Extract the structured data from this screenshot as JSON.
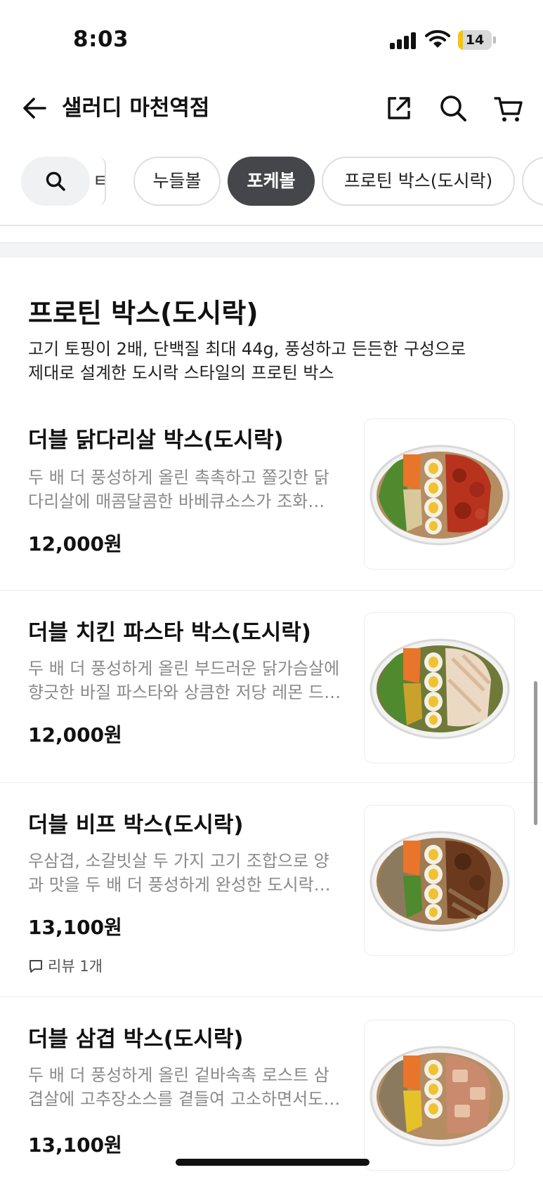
{
  "status_bar": {
    "time": "8:03",
    "battery": "14"
  },
  "header": {
    "store_name": "샐러디 마천역점"
  },
  "categories": {
    "partial_left": "ㅌ",
    "chips": [
      "누들볼",
      "포케볼",
      "프로틴 박스(도시락)"
    ],
    "active": "포케볼"
  },
  "section": {
    "title": "프로틴 박스(도시락)",
    "desc_line1": "고기 토핑이 2배, 단백질 최대 44g, 풍성하고 든든한 구성으로",
    "desc_line2": "제대로 설계한 도시락 스타일의 프로틴 박스"
  },
  "items": [
    {
      "name": "더블 닭다리살 박스(도시락)",
      "desc_line1": "두 배 더 풍성하게 올린 촉촉하고 쫄깃한 닭",
      "desc_line2": "다리살에 매콤달콤한 바베큐소스가 조화…",
      "price": "12,000원"
    },
    {
      "name": "더블 치킨 파스타 박스(도시락)",
      "desc_line1": "두 배 더 풍성하게 올린 부드러운 닭가슴살에",
      "desc_line2": "향긋한 바질 파스타와 상큼한 저당 레몬 드…",
      "price": "12,000원"
    },
    {
      "name": "더블 비프 박스(도시락)",
      "desc_line1": "우삼겹, 소갈빗살 두 가지 고기 조합으로 양",
      "desc_line2": "과 맛을 두 배 더 풍성하게 완성한 도시락…",
      "price": "13,100원",
      "review": "리뷰 1개"
    },
    {
      "name": "더블 삼겹 박스(도시락)",
      "desc_line1": "두 배 더 풍성하게 올린 겉바속촉 로스트 삼",
      "desc_line2": "겹살에 고추장소스를 곁들여 고소하면서도…",
      "price": "13,100원"
    }
  ],
  "colors": {
    "active_chip": "#444649",
    "desc_gray": "#8a8a8a",
    "battery_fill": "#f7c400"
  },
  "icons": [
    "back-arrow-icon",
    "share-icon",
    "search-icon",
    "cart-icon",
    "comment-icon"
  ]
}
